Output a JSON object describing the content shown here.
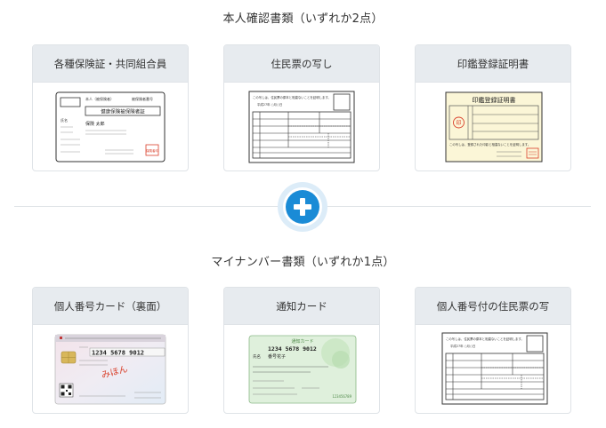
{
  "section1": {
    "title": "本人確認書類（いずれか2点）",
    "cards": [
      {
        "label": "各種保険証・共同組合員",
        "image": "insurance-card-image"
      },
      {
        "label": "住民票の写し",
        "image": "resident-record-image"
      },
      {
        "label": "印鑑登録証明書",
        "image": "seal-certificate-image"
      }
    ]
  },
  "divider_icon": "plus-icon",
  "section2": {
    "title": "マイナンバー書類（いずれか1点）",
    "cards": [
      {
        "label": "個人番号カード（裏面）",
        "image": "my-number-card-back-image"
      },
      {
        "label": "通知カード",
        "image": "notification-card-image"
      },
      {
        "label": "個人番号付の住民票の写",
        "image": "resident-record-with-number-image"
      }
    ]
  },
  "thumbs": {
    "insurance": {
      "top_small": "本人（被保険者）",
      "top_right": "被保険者番号",
      "title": "健康保険被保険者証",
      "name_label": "氏名",
      "name": "保険 太郎",
      "seal": "保険者印"
    },
    "resident": {
      "header": "この写しは、住民票の原本と相違ないことを証明します。",
      "date": "平成27年 ○月○日"
    },
    "seal_cert": {
      "title": "印鑑登録証明書",
      "stamp": "印",
      "footer": "この写しは、登録された印影と相違ないことを証明します。"
    },
    "mynumber": {
      "number": "1234 5678 9012",
      "stamp": "みほん"
    },
    "notify": {
      "title": "通知カード",
      "number": "1234 5678 9012",
      "name_label": "氏名",
      "name": "番号花子",
      "footer": "123456789"
    },
    "resident2": {
      "header": "この写しは、住民票の原本と相違ないことを証明します。",
      "date": "平成27年 ○月○日"
    }
  },
  "colors": {
    "accent": "#1a8bd6",
    "header_bg": "#e7ebef",
    "seal_red": "#d9402b"
  }
}
